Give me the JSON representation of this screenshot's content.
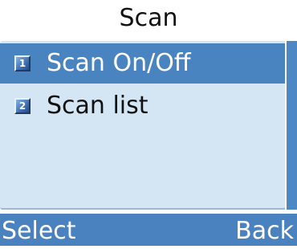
{
  "screen": {
    "title": "Scan"
  },
  "menu": {
    "items": [
      {
        "number": "1",
        "label": "Scan On/Off",
        "selected": true,
        "icon": "number-1-icon"
      },
      {
        "number": "2",
        "label": "Scan list",
        "selected": false,
        "icon": "number-2-icon"
      }
    ]
  },
  "softkeys": {
    "left": "Select",
    "right": "Back"
  },
  "colors": {
    "highlight": "#4a84c0",
    "panel": "#d4e6f4",
    "softkey_bar": "#4a82bf"
  }
}
